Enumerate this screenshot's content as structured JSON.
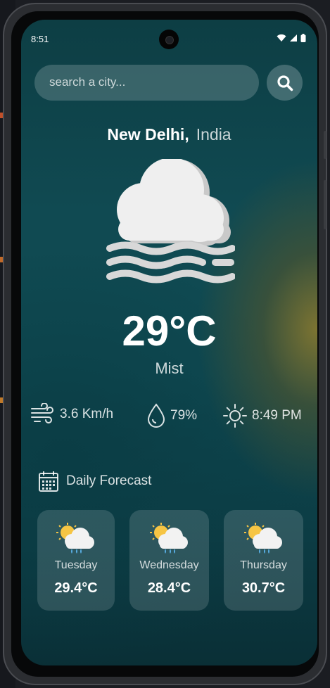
{
  "status": {
    "time": "8:51"
  },
  "search": {
    "placeholder": "search a city..."
  },
  "location": {
    "city": "New Delhi,",
    "country": "India"
  },
  "current": {
    "temperature": "29°C",
    "condition": "Mist",
    "icon": "mist-cloud-icon"
  },
  "stats": {
    "wind": "3.6 Km/h",
    "humidity": "79%",
    "sunset": "8:49 PM"
  },
  "daily": {
    "title": "Daily Forecast",
    "days": [
      {
        "name": "Tuesday",
        "temp": "29.4°C",
        "icon": "sun-cloud-rain-icon"
      },
      {
        "name": "Wednesday",
        "temp": "28.4°C",
        "icon": "sun-cloud-rain-icon"
      },
      {
        "name": "Thursday",
        "temp": "30.7°C",
        "icon": "sun-cloud-rain-icon"
      }
    ]
  },
  "colors": {
    "accent_bg": "#0f4a52",
    "glow": "#827630",
    "text": "#ffffff"
  }
}
